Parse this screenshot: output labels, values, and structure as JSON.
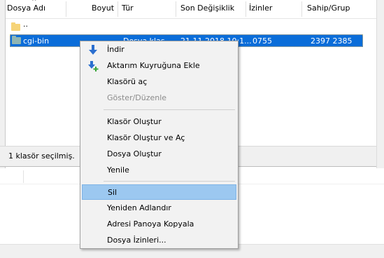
{
  "columns": {
    "name": "Dosya Adı",
    "size": "Boyut",
    "type": "Tür",
    "modified": "Son Değişiklik",
    "permissions": "İzinler",
    "owner": "Sahip/Grup"
  },
  "rows": [
    {
      "name": "..",
      "size": "",
      "type": "",
      "modified": "",
      "permissions": "",
      "owner": ""
    },
    {
      "name": "cgi-bin",
      "size": "",
      "type": "Dosya klas...",
      "modified": "21.11.2018 10:1...",
      "permissions": "0755",
      "owner": "2397 2385"
    }
  ],
  "status": {
    "text": "1 klasör seçilmiş."
  },
  "context_menu": {
    "items": [
      {
        "label": "İndir",
        "icon": "download-arrow-icon",
        "enabled": true
      },
      {
        "label": "Aktarım Kuyruğuna Ekle",
        "icon": "add-to-queue-icon",
        "enabled": true
      },
      {
        "label": "Klasörü aç",
        "enabled": true
      },
      {
        "label": "Göster/Düzenle",
        "enabled": false
      },
      {
        "label": "Klasör Oluştur",
        "enabled": true
      },
      {
        "label": "Klasör Oluştur ve Aç",
        "enabled": true
      },
      {
        "label": "Dosya Oluştur",
        "enabled": true
      },
      {
        "label": "Yenile",
        "enabled": true
      },
      {
        "label": "Sil",
        "enabled": true,
        "highlighted": true
      },
      {
        "label": "Yeniden Adlandır",
        "enabled": true
      },
      {
        "label": "Adresi Panoya Kopyala",
        "enabled": true
      },
      {
        "label": "Dosya İzinleri...",
        "enabled": true
      }
    ]
  },
  "colors": {
    "selection": "#0a6dd9",
    "menu_highlight": "#9cc8f0",
    "folder": "#f6d478",
    "download_arrow": "#2b6fcf",
    "add_plus": "#3aa53a"
  }
}
